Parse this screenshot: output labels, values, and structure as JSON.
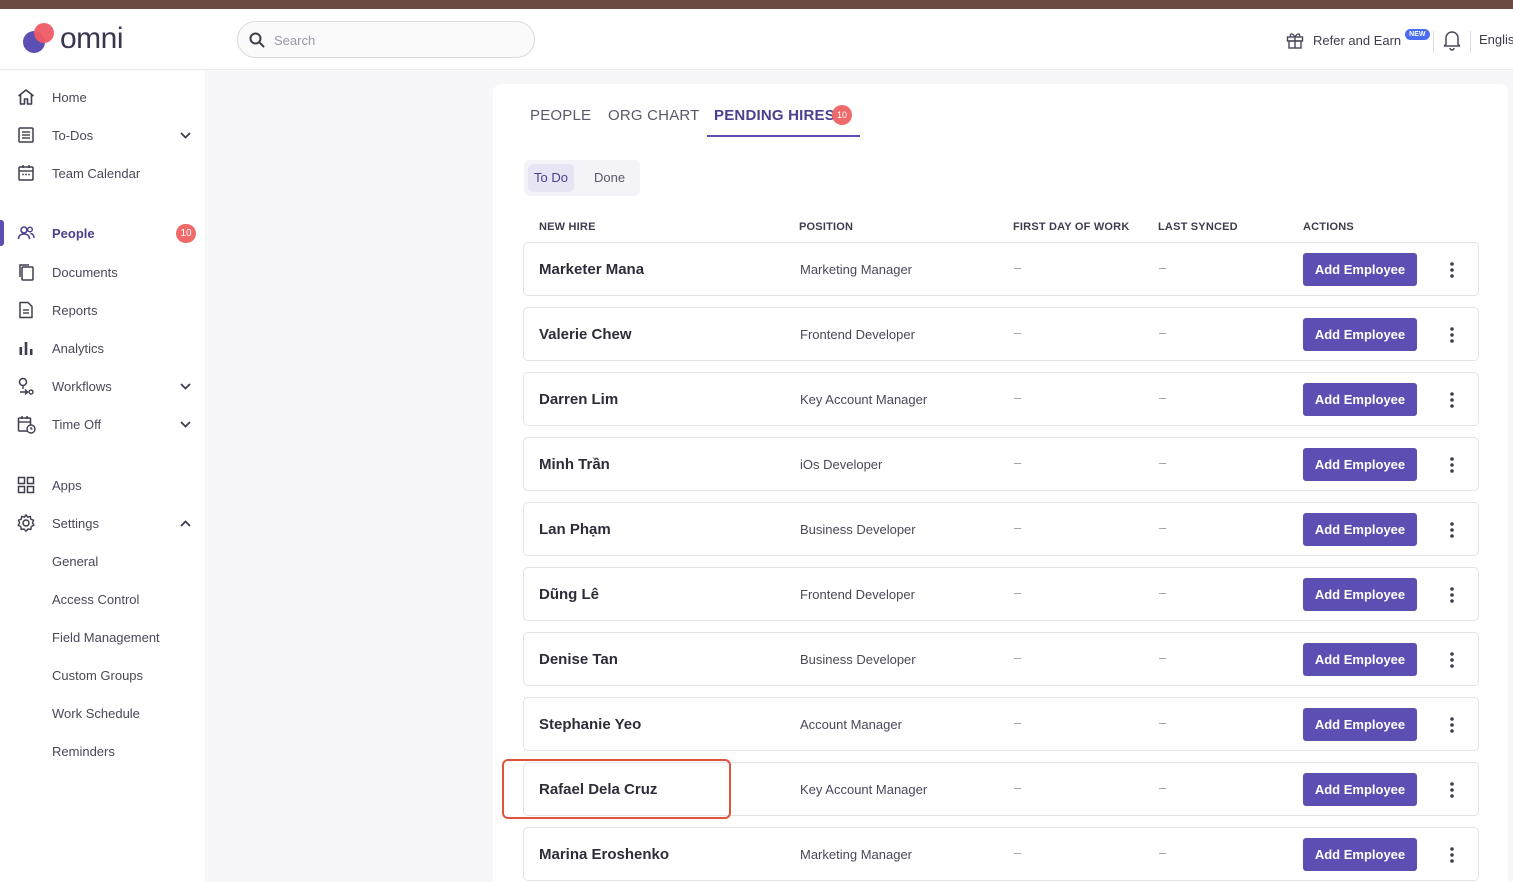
{
  "header": {
    "logo_text": "omni",
    "search_placeholder": "Search",
    "refer_label": "Refer and Earn",
    "refer_badge": "NEW",
    "language": "Englis"
  },
  "sidebar": {
    "items": [
      {
        "label": "Home",
        "icon": "home-icon"
      },
      {
        "label": "To-Dos",
        "icon": "checklist-icon",
        "expandable": true
      },
      {
        "label": "Team Calendar",
        "icon": "calendar-icon"
      },
      {
        "label": "People",
        "icon": "people-icon",
        "active": true,
        "badge": "10"
      },
      {
        "label": "Documents",
        "icon": "documents-icon"
      },
      {
        "label": "Reports",
        "icon": "report-icon"
      },
      {
        "label": "Analytics",
        "icon": "bar-chart-icon"
      },
      {
        "label": "Workflows",
        "icon": "workflow-icon",
        "expandable": true
      },
      {
        "label": "Time Off",
        "icon": "time-off-icon",
        "expandable": true
      },
      {
        "label": "Apps",
        "icon": "apps-icon"
      },
      {
        "label": "Settings",
        "icon": "gear-icon",
        "expanded": true
      }
    ],
    "settings_sub": [
      "General",
      "Access Control",
      "Field Management",
      "Custom Groups",
      "Work Schedule",
      "Reminders"
    ]
  },
  "tabs": {
    "people": "PEOPLE",
    "org_chart": "ORG CHART",
    "pending_hires": "PENDING HIRES",
    "pending_count": "10"
  },
  "segment": {
    "todo": "To Do",
    "done": "Done"
  },
  "table": {
    "headers": {
      "new_hire": "NEW HIRE",
      "position": "POSITION",
      "first_day": "FIRST DAY OF WORK",
      "last_synced": "LAST SYNCED",
      "actions": "ACTIONS"
    },
    "action_label": "Add Employee",
    "empty_value": "–",
    "rows": [
      {
        "name": "Marketer Mana",
        "position": "Marketing Manager"
      },
      {
        "name": "Valerie Chew",
        "position": "Frontend Developer"
      },
      {
        "name": "Darren Lim",
        "position": "Key Account Manager"
      },
      {
        "name": "Minh Trần",
        "position": "iOs Developer"
      },
      {
        "name": "Lan Phạm",
        "position": "Business Developer"
      },
      {
        "name": "Dũng Lê",
        "position": "Frontend Developer"
      },
      {
        "name": "Denise Tan",
        "position": "Business Developer"
      },
      {
        "name": "Stephanie Yeo",
        "position": "Account Manager"
      },
      {
        "name": "Rafael Dela Cruz",
        "position": "Key Account Manager",
        "highlighted": true
      },
      {
        "name": "Marina Eroshenko",
        "position": "Marketing Manager"
      }
    ]
  },
  "colors": {
    "accent": "#5b4fb3",
    "badge": "#ef6b6b",
    "highlight": "#e0533f"
  }
}
